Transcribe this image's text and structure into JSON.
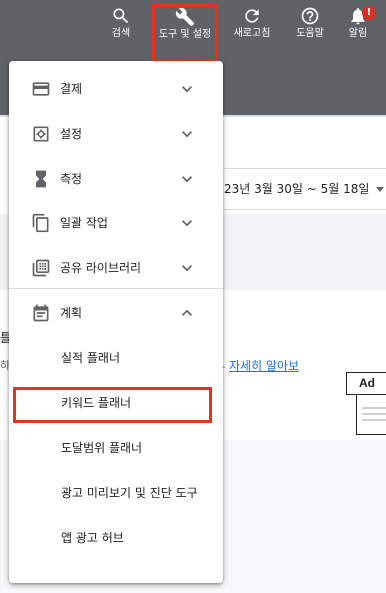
{
  "toolbar": {
    "search_label": "검색",
    "tools_label": "도구 및 설정",
    "refresh_label": "새로고침",
    "help_label": "도움말",
    "alerts_label": "알림",
    "alerts_badge": "!",
    "icons": [
      "search-icon",
      "wrench-icon",
      "refresh-icon",
      "help-icon",
      "bell-icon"
    ],
    "background_color": "#5f6368",
    "highlight_color": "#e8321e"
  },
  "date_range": {
    "text": "23년 3월 30일 ~ 5월 18일"
  },
  "content": {
    "learn_more_prefix": ".",
    "learn_more_link": "자세히 알아보",
    "ad_illustration_label": "Ad"
  },
  "menu": {
    "sections": [
      {
        "label": "결제",
        "icon": "credit-card-icon",
        "expanded": false
      },
      {
        "label": "설정",
        "icon": "settings-icon",
        "expanded": false
      },
      {
        "label": "측정",
        "icon": "hourglass-icon",
        "expanded": false
      },
      {
        "label": "일괄 작업",
        "icon": "copy-icon",
        "expanded": false
      },
      {
        "label": "공유 라이브러리",
        "icon": "library-icon",
        "expanded": false
      },
      {
        "label": "계획",
        "icon": "calendar-icon",
        "expanded": true
      }
    ],
    "planning_items": [
      {
        "label": "실적 플래너"
      },
      {
        "label": "키워드 플래너",
        "highlighted": true
      },
      {
        "label": "도달범위 플래너"
      },
      {
        "label": "광고 미리보기 및 진단 도구"
      },
      {
        "label": "앱 광고 허브"
      }
    ]
  }
}
